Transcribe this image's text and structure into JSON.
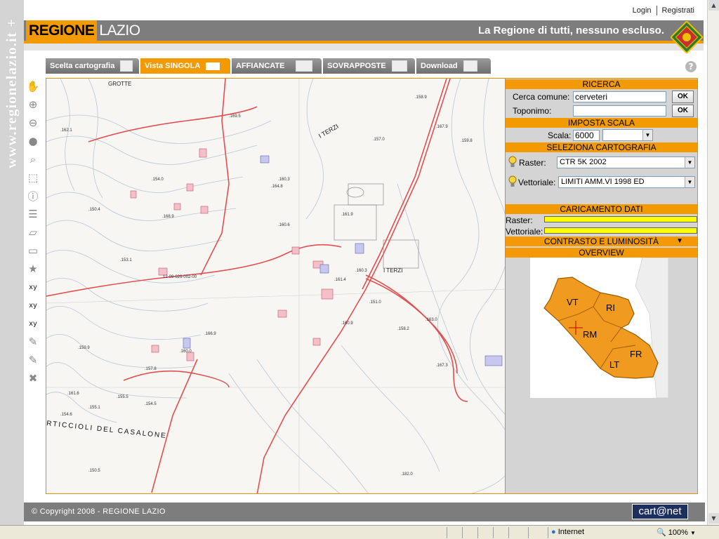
{
  "side_url": "www.regionelazio.it +",
  "top_links": {
    "login": "Login",
    "register": "Registrati"
  },
  "header": {
    "brand_a": "REGIONE",
    "brand_b": "LAZIO",
    "slogan": "La Regione di tutti, nessuno escluso."
  },
  "tabs": [
    {
      "label": "Scelta cartografia",
      "active": false
    },
    {
      "label": "Vista SINGOLA",
      "active": true
    },
    {
      "label": "AFFIANCATE",
      "active": false
    },
    {
      "label": "SOVRAPPOSTE",
      "active": false
    },
    {
      "label": "Download",
      "active": false
    }
  ],
  "help_label": "?",
  "toolbar": {
    "tools": [
      "hand-icon",
      "zoom-in-icon",
      "zoom-out-icon",
      "globe-icon",
      "magnifier-icon",
      "zoom-box-icon",
      "info-icon",
      "list-icon",
      "layer-icon",
      "window-icon",
      "star-icon",
      "xy-plus-icon",
      "xy-pointer-icon",
      "xy-text-icon",
      "ruler-icon",
      "area-icon",
      "clear-icon"
    ],
    "xy_label": "xy"
  },
  "panel": {
    "ricerca": "RICERCA",
    "cerca_comune_label": "Cerca comune:",
    "cerca_comune_value": "cerveteri",
    "toponimo_label": "Toponimo:",
    "toponimo_value": "",
    "ok_label": "OK",
    "imposta_scala": "IMPOSTA SCALA",
    "scala_label": "Scala:",
    "scala_value": "6000",
    "seleziona_cartografia": "SELEZIONA CARTOGRAFIA",
    "raster_label": "Raster:",
    "raster_value": "CTR  5K 2002",
    "vettoriale_label": "Vettoriale:",
    "vettoriale_value": "LIMITI AMM.VI 1998 ED",
    "caricamento_dati": "CARICAMENTO DATI",
    "load_raster_label": "Raster:",
    "load_vettoriale_label": "Vettoriale:",
    "contrasto": "CONTRASTO E LUMINOSITÀ",
    "overview": "OVERVIEW",
    "provinces": [
      "VT",
      "RI",
      "RM",
      "FR",
      "LT"
    ]
  },
  "map_labels": {
    "grotte": "GROTTE",
    "terzi_top": "I TERZI",
    "terzi_mid": "I TERZI",
    "casalone": "RTICCIOLI DEL CASALONE",
    "sheet_id": "12-09-026-002-00",
    "spot_heights": [
      ".162.1",
      ".169.5",
      ".160.3",
      ".160.6",
      ".161.9",
      ".160.3",
      ".158.9",
      ".157.0",
      ".150.4",
      ".154.0",
      ".153.1",
      ".168.9",
      ".161.4",
      ".158.2",
      ".163.0",
      ".167.9",
      ".154.6",
      ".166.9",
      ".160.0",
      ".182.0",
      ".159.8",
      ".150.5",
      ".155.1",
      ".161.6",
      ".155.5",
      ".157.8",
      ".154.5",
      ".151.0",
      ".160.9",
      ".164.8",
      ".167.3",
      ".159.9"
    ]
  },
  "footer": {
    "copyright": "© Copyright 2008 - REGIONE LAZIO",
    "partner": "cart@net"
  },
  "statusbar": {
    "zone": "Internet",
    "zoom": "100%"
  },
  "colors": {
    "accent": "#f39a00",
    "header_gray": "#7d7d7d",
    "panel_bg": "#d4d4d4",
    "progress": "#ffff00",
    "road": "#e05050"
  }
}
